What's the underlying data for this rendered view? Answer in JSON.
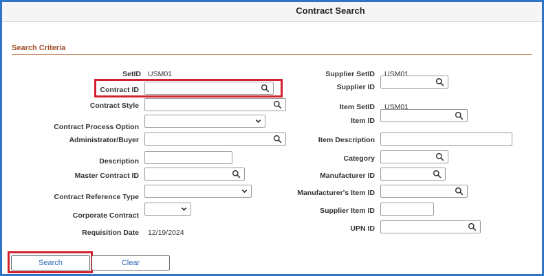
{
  "page": {
    "title": "Contract Search"
  },
  "section": {
    "title": "Search Criteria"
  },
  "fields": {
    "setid": {
      "label": "SetID",
      "value": "USM01"
    },
    "contract_id": {
      "label": "Contract ID",
      "value": ""
    },
    "contract_style": {
      "label": "Contract Style",
      "value": ""
    },
    "contract_process_option": {
      "label": "Contract Process Option",
      "value": ""
    },
    "administrator_buyer": {
      "label": "Administrator/Buyer",
      "value": ""
    },
    "description": {
      "label": "Description",
      "value": ""
    },
    "master_contract_id": {
      "label": "Master Contract ID",
      "value": ""
    },
    "contract_reference_type": {
      "label": "Contract Reference Type",
      "value": ""
    },
    "corporate_contract": {
      "label": "Corporate Contract",
      "value": ""
    },
    "requisition_date": {
      "label": "Requisition Date",
      "value": "12/19/2024"
    },
    "supplier_setid": {
      "label": "Supplier SetID",
      "value": "USM01"
    },
    "supplier_id": {
      "label": "Supplier ID",
      "value": ""
    },
    "item_setid": {
      "label": "Item SetID",
      "value": "USM01"
    },
    "item_id": {
      "label": "Item ID",
      "value": ""
    },
    "item_description": {
      "label": "Item Description",
      "value": ""
    },
    "category": {
      "label": "Category",
      "value": ""
    },
    "manufacturer_id": {
      "label": "Manufacturer ID",
      "value": ""
    },
    "manufacturers_item_id": {
      "label": "Manufacturer's Item ID",
      "value": ""
    },
    "supplier_item_id": {
      "label": "Supplier Item ID",
      "value": ""
    },
    "upn_id": {
      "label": "UPN ID",
      "value": ""
    }
  },
  "buttons": {
    "search": "Search",
    "clear": "Clear"
  },
  "icons": {
    "lookup": "search-icon",
    "dropdown": "chevron-down-icon"
  },
  "colors": {
    "accent_border": "#2f74c6",
    "highlight": "#d3202f",
    "section_title": "#a0522d",
    "button_text": "#2f6ab3"
  }
}
